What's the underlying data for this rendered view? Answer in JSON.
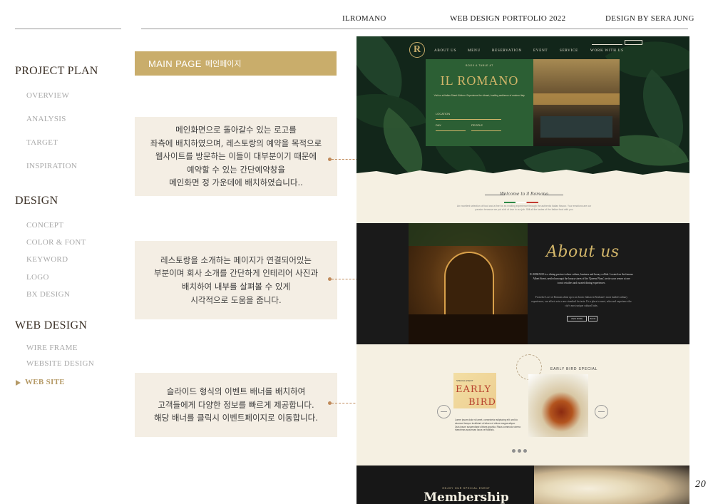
{
  "header": {
    "brand": "ILROMANO",
    "portfolio": "WEB DESIGN PORTFOLIO 2022",
    "designer": "DESIGN BY SERA JUNG"
  },
  "sidebar": {
    "sections": [
      {
        "title": "PROJECT PLAN",
        "items": [
          "OVERVIEW",
          "ANALYSIS",
          "TARGET",
          "INSPIRATION"
        ]
      },
      {
        "title": "DESIGN",
        "items": [
          "CONCEPT",
          "COLOR & FONT",
          "KEYWORD",
          "LOGO",
          "BX DESIGN"
        ]
      },
      {
        "title": "WEB DESIGN",
        "items": [
          "WIRE FRAME",
          "WEBSITE DESIGN",
          "WEB SITE"
        ]
      }
    ],
    "active_item": "WEB SITE"
  },
  "banner": {
    "title": "MAIN PAGE",
    "subtitle": "메인페이지"
  },
  "notes": [
    [
      "메인화면으로 돌아갈수 있는 로고를",
      "좌측에 배치하였으며, 레스토랑의 예약을 목적으로",
      "웹사이트를 방문하는 이들이 대부분이기 때문에",
      "예약할 수 있는 간단예약창을",
      "메인화면 정 가운데에 배치하였습니다.."
    ],
    [
      "레스토랑을 소개하는 페이지가 연결되어있는",
      "부분이며 회사 소개를 간단하게 인테리어 사진과",
      "배치하여 내부를 살펴볼 수 있게",
      "시각적으로 도움을 줍니다."
    ],
    [
      "슬라이드 형식의 이벤트 배너를 배치하여",
      "고객들에게 다양한 정보를 빠르게 제공합니다.",
      "해당 배너를 클릭시 이벤트페이지로 이동합니다."
    ]
  ],
  "mockup": {
    "logo_letter": "R",
    "nav": [
      "ABOUT US",
      "MENU",
      "RESERVATION",
      "EVENT",
      "SERVICE",
      "WORK WITH US"
    ],
    "booking": {
      "subtitle": "BOOK A TABLE AT",
      "title": "IL ROMANO",
      "description": "Visit us at Italian Street Kitchen. Experience the vibrant, bustling ambience of modern Italy.",
      "field_location": "LOCATION",
      "field_date": "DAY",
      "field_people": "PEOPLE"
    },
    "welcome": {
      "script": "Welcome to il Romano",
      "text": "An excellent selection of food and a fine for an exciting experience through the authentic Italian flavour. Your emotions are our passion because we put a bit of love in our job. Still all the tastes of the Italian food with you"
    },
    "about": {
      "title": "About us",
      "text1": "IL ROMANO is a dining precinct where culture, business and luxury collide. Located on the famous Albert Street, nestled amongst the luxury stores of the 'Queens Plaza', invite your senses at one iconic retailers and curated dining experiences.",
      "text2": "From the Love of Romans shine up to an Iconic Italian in Brisbane's most loaded culinary experiences, our efforts sets a new standard for taste. It's a place to meet, relax and experience the city's most unique cultural hubs.",
      "button_more": "VIEW MORE",
      "button_book": "BOOK"
    },
    "event": {
      "sign_small": "SPECIAL EVENT",
      "sign_line1": "EARLY",
      "sign_line2": "BIRD",
      "description": "Lorem ipsum dolor sit amet, consectetur adipiscing elit, sed do eiusmod tempor incididunt ut labore et dolore magna aliqua. Quis ipsum suspendisse ultrices gravida. Risus commodo viverra maecenas accumsan lacus vel facilisis.",
      "title": "EARLY BIRD SPECIAL"
    },
    "membership": {
      "subtitle": "ENJOY OUR SPECIAL EVENT",
      "title": "Membership"
    }
  },
  "page_number": "20",
  "colors": {
    "gold": "#c9ad6b",
    "accent": "#c08a5a",
    "note_bg": "#f4eee4",
    "green": "#2c5f34"
  }
}
